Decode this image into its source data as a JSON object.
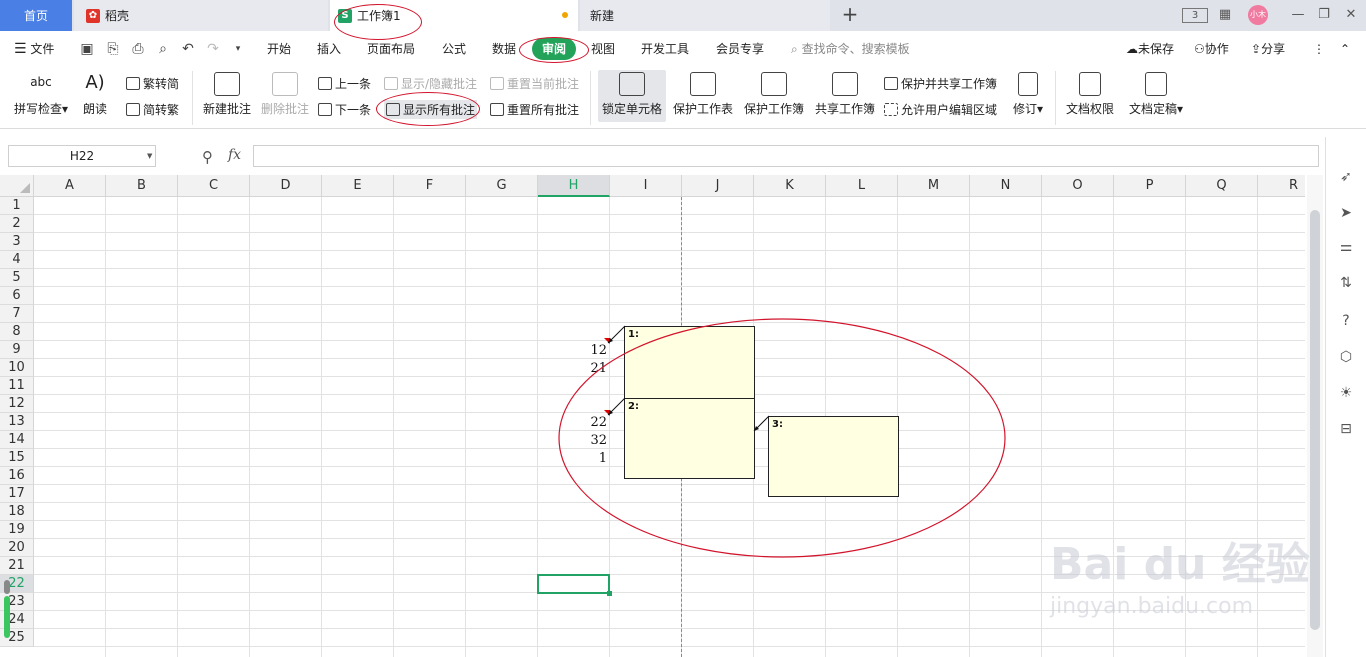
{
  "tabs": {
    "home": "首页",
    "daoke": "稻壳",
    "workbook": "工作簿1",
    "new_tab": "新建",
    "add": "+"
  },
  "window": {
    "screen_badge": "3",
    "user_badge": "小木"
  },
  "menu": {
    "file": "文件",
    "items": [
      "开始",
      "插入",
      "页面布局",
      "公式",
      "数据",
      "审阅",
      "视图",
      "开发工具",
      "会员专享"
    ],
    "search_placeholder": "查找命令、搜索模板",
    "unsaved": "未保存",
    "collaborate": "协作",
    "share": "分享"
  },
  "ribbon": {
    "spellcheck": "拼写检查",
    "read_aloud": "朗读",
    "trad_to_simp": "繁转简",
    "simp_to_trad": "简转繁",
    "new_comment": "新建批注",
    "delete_comment": "删除批注",
    "prev": "上一条",
    "next": "下一条",
    "show_hide_comment": "显示/隐藏批注",
    "show_all_comments": "显示所有批注",
    "reset_current_comment": "重置当前批注",
    "reset_all_comments": "重置所有批注",
    "lock_cell": "锁定单元格",
    "protect_sheet": "保护工作表",
    "protect_workbook": "保护工作簿",
    "share_workbook": "共享工作簿",
    "protect_and_share": "保护并共享工作簿",
    "allow_edit_ranges": "允许用户编辑区域",
    "revise": "修订",
    "doc_permission": "文档权限",
    "doc_finalize": "文档定稿"
  },
  "formula_bar": {
    "name_box": "H22",
    "fx": "fx",
    "formula": ""
  },
  "sheet": {
    "columns": [
      "A",
      "B",
      "C",
      "D",
      "E",
      "F",
      "G",
      "H",
      "I",
      "J",
      "K",
      "L",
      "M",
      "N",
      "O",
      "P",
      "Q",
      "R"
    ],
    "selected_column": "H",
    "rows": [
      "1",
      "2",
      "3",
      "4",
      "5",
      "6",
      "7",
      "8",
      "9",
      "10",
      "11",
      "12",
      "13",
      "14",
      "15",
      "16",
      "17",
      "18",
      "19",
      "20",
      "21",
      "22",
      "23",
      "24",
      "25"
    ],
    "selected_row": "22",
    "cells": [
      {
        "ref": "H9",
        "value": "12"
      },
      {
        "ref": "H10",
        "value": "21"
      },
      {
        "ref": "H13",
        "value": "22"
      },
      {
        "ref": "H14",
        "value": "32"
      },
      {
        "ref": "H15",
        "value": "1"
      }
    ],
    "comments": [
      {
        "id": "1",
        "label": "1:",
        "text": ""
      },
      {
        "id": "2",
        "label": "2:",
        "text": ""
      },
      {
        "id": "3",
        "label": "3:",
        "text": ""
      }
    ]
  },
  "watermark": {
    "logo": "Bai du 经验",
    "url": "jingyan.baidu.com"
  },
  "colors": {
    "accent_green": "#21a366",
    "review_tab": "#23a35a",
    "home_tab": "#4a7fe6",
    "comment_fill": "#ffffe1",
    "annotation_red": "#d2142c"
  }
}
